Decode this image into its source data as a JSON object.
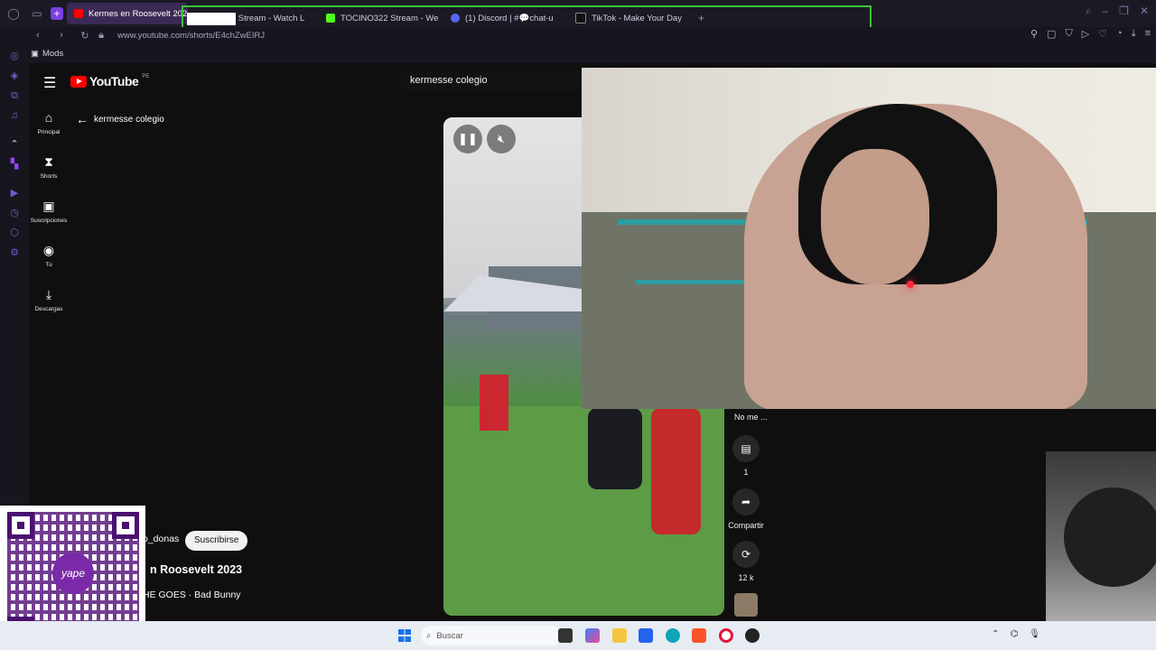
{
  "browser": {
    "active_tab": "Kermes en Roosevelt 202",
    "tabs": [
      "EZooin Stream - Watch L",
      "TOCINO322 Stream - We",
      "(1) Discord | #💬chat-u",
      "TikTok - Make Your Day"
    ],
    "url": "www.youtube.com/shorts/E4chZwEIRJ",
    "bookmark": "Mods"
  },
  "youtube": {
    "logo_text": "YouTube",
    "country": "PE",
    "search_value": "kermesse colegio",
    "back_label": "kermesse colegio",
    "nav": [
      {
        "label": "Principal",
        "icon": "home-icon"
      },
      {
        "label": "Shorts",
        "icon": "shorts-icon"
      },
      {
        "label": "Suscripciones",
        "icon": "subscriptions-icon"
      },
      {
        "label": "Tú",
        "icon": "user-icon"
      },
      {
        "label": "Descargas",
        "icon": "download-icon"
      }
    ],
    "short": {
      "channel": "o_donas",
      "subscribe_label": "Suscribirse",
      "title": "n Roosevelt 2023",
      "music": "HE GOES · Bad Bunny",
      "dislike_label": "No me ...",
      "comments_count": "1",
      "share_label": "Compartir",
      "remix_count": "12 k"
    }
  },
  "taskbar": {
    "search_placeholder": "Buscar"
  },
  "colors": {
    "tab_group_border": "#37c637",
    "youtube_red": "#ff0000",
    "yape_purple": "#7a2aa8"
  },
  "qr": {
    "brand": "yape"
  }
}
